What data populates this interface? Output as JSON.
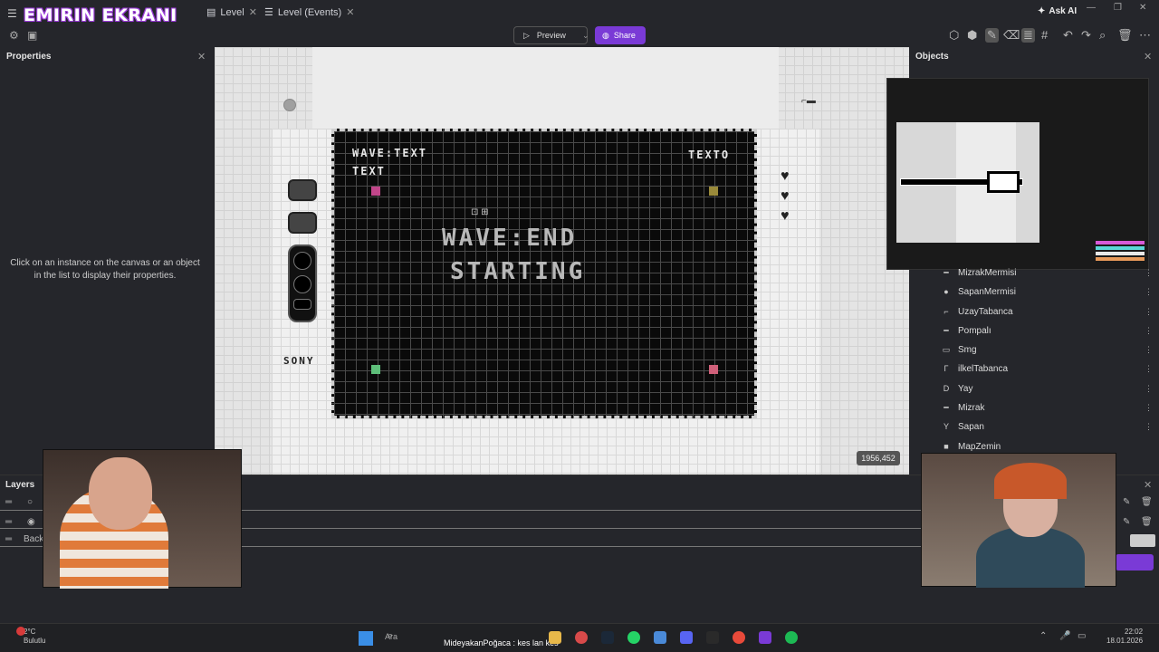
{
  "overlay_title": "EMIRIN EKRANI",
  "tabs": [
    {
      "label": "Level"
    },
    {
      "label": "Level (Events)"
    }
  ],
  "top_right": {
    "ask_ai": "Ask AI"
  },
  "toolbar": {
    "preview_label": "Preview",
    "share_label": "Share"
  },
  "properties": {
    "title": "Properties",
    "hint": "Click on an instance on the canvas or an object in the list to display their properties."
  },
  "canvas": {
    "hud_wave": "WAVE:TEXT",
    "hud_text": "TEXT",
    "hud_texto": "TEXTO",
    "wave_line1": "WAVE:END",
    "wave_line2": "STARTING",
    "console_brand": "SONY",
    "coords": "1956,452",
    "square_colors": [
      "#c2468a",
      "#9a8a3a",
      "#5ebf7a",
      "#d0607a"
    ]
  },
  "objects": {
    "title": "Objects",
    "items": [
      {
        "label": "MizrakMermisi",
        "icon": "spear-icon"
      },
      {
        "label": "SapanMermisi",
        "icon": "pebble-icon"
      },
      {
        "label": "UzayTabanca",
        "icon": "pistol-icon"
      },
      {
        "label": "Pompalı",
        "icon": "shotgun-icon"
      },
      {
        "label": "Smg",
        "icon": "smg-icon"
      },
      {
        "label": "ilkelTabanca",
        "icon": "pistol-icon"
      },
      {
        "label": "Yay",
        "icon": "bow-icon"
      },
      {
        "label": "Mizrak",
        "icon": "spear-icon"
      },
      {
        "label": "Sapan",
        "icon": "slingshot-icon"
      },
      {
        "label": "MapZemin",
        "icon": "tile-icon"
      }
    ]
  },
  "layers": {
    "title": "Layers",
    "back_label": "Back"
  },
  "taskbar": {
    "weather_temp": "2°C",
    "weather_desc": "Bulutlu",
    "search_placeholder": "Ara",
    "ticker": "MideyakanPoğaca : kes lan kes",
    "time": "22:02",
    "date": "18.01.2026"
  },
  "accent_color": "#7a3ad6"
}
